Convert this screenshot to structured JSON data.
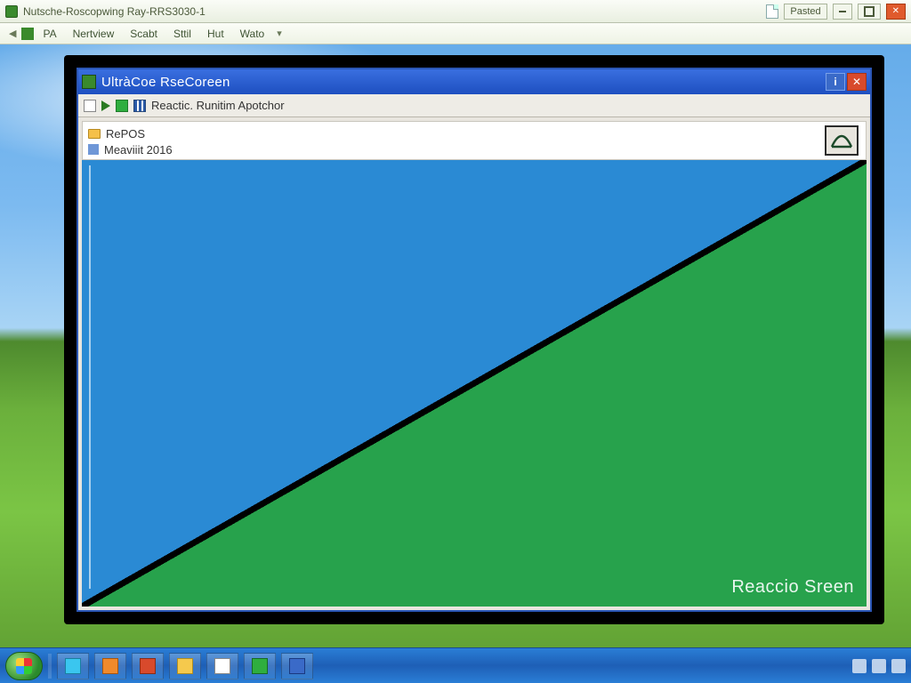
{
  "host_window": {
    "title": "Nutsche-Roscopwing Ray-RRS3030-1",
    "paused_label": "Pasted",
    "menu": [
      "PA",
      "Nertview",
      "Scabt",
      "Sttil",
      "Hut",
      "Wato"
    ]
  },
  "app_window": {
    "title": "UltràCoe RseCoreen",
    "toolbar_label": "Reactic. Runitim Apotchor",
    "watermark": "Reaccio Sreen"
  },
  "list": {
    "items": [
      {
        "icon": "folder",
        "label": "RePOS"
      },
      {
        "icon": "blue",
        "label": "Meaviiit 2016"
      }
    ]
  },
  "colors": {
    "title_blue": "#2a5ed0",
    "canvas_blue": "#2a8ad4",
    "canvas_green": "#27a24c"
  }
}
